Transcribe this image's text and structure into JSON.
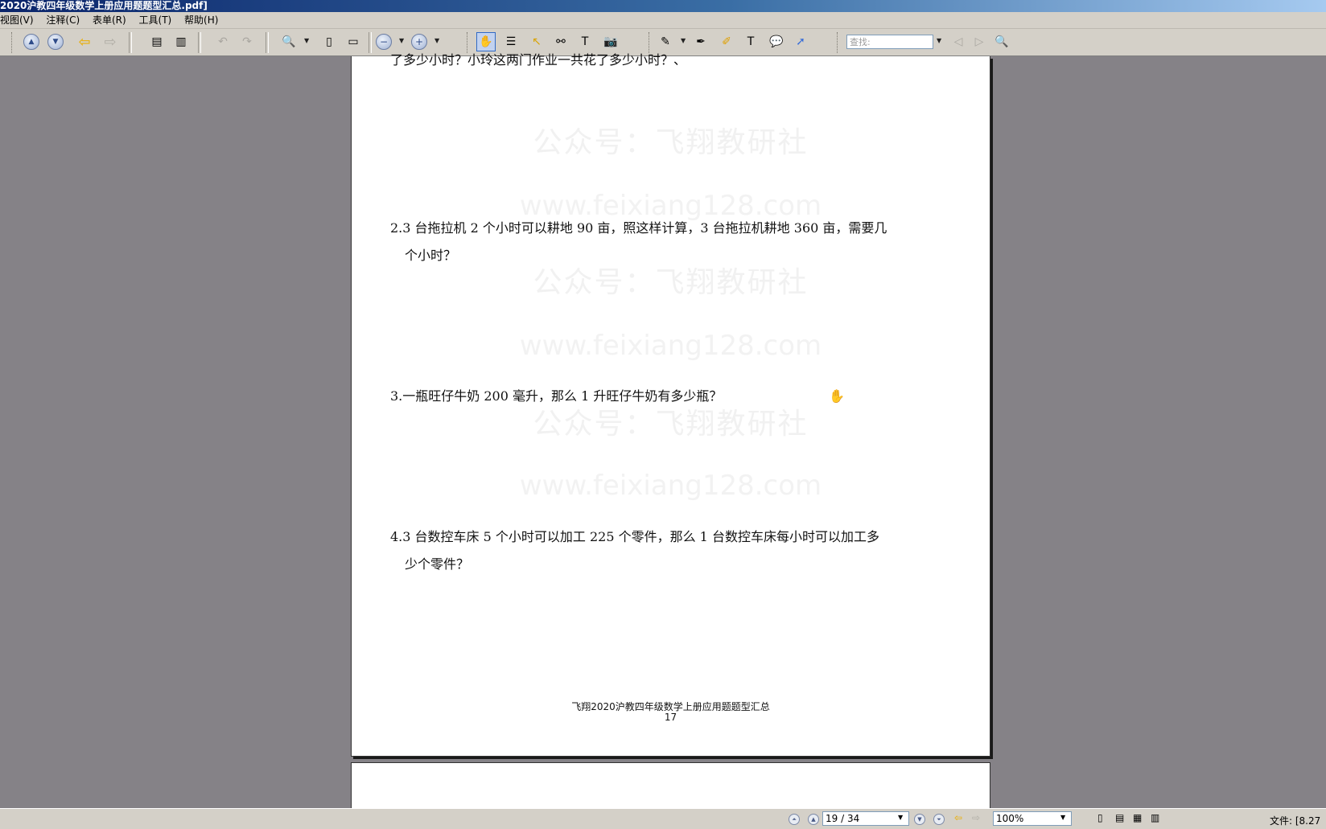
{
  "window": {
    "title": "2020沪教四年级数学上册应用题题型汇总.pdf]"
  },
  "menu": [
    "视图(V)",
    "注释(C)",
    "表单(R)",
    "工具(T)",
    "帮助(H)"
  ],
  "toolbar": {
    "search_placeholder": "查找:",
    "icons": [
      "prev-page-icon",
      "next-page-icon",
      "back-icon",
      "forward-icon",
      "extract-pages-icon",
      "insert-pages-icon",
      "undo-icon",
      "redo-icon",
      "zoom-in-tool-icon",
      "fit-page-icon",
      "fit-width-icon",
      "zoom-out-icon",
      "zoom-in-icon",
      "hand-tool-icon",
      "select-text-icon",
      "select-tool-icon",
      "find-icon",
      "typewriter-icon",
      "snapshot-icon",
      "edit-icon",
      "stamp-icon",
      "note-icon",
      "textbox-icon",
      "comment-icon",
      "arrow-icon",
      "search-prev-icon",
      "search-next-icon",
      "search-options-icon"
    ]
  },
  "document": {
    "partial_top_line": "了多少小时？小玲这两门作业一共花了多少小时？、",
    "watermark_cn": "公众号：飞翔教研社",
    "watermark_url": "www.feixiang128.com",
    "questions": [
      {
        "line1": "2.3 台拖拉机 2 个小时可以耕地 90 亩，照这样计算，3 台拖拉机耕地 360 亩，需要几",
        "line2": "个小时？"
      },
      {
        "line1": "3.一瓶旺仔牛奶 200 毫升，那么 1 升旺仔牛奶有多少瓶？",
        "line2": ""
      },
      {
        "line1": "4.3 台数控车床 5 个小时可以加工 225 个零件，那么 1 台数控车床每小时可以加工多",
        "line2": "少个零件？"
      }
    ],
    "footer_title": "飞翔2020沪教四年级数学上册应用题题型汇总",
    "footer_page": "17"
  },
  "status": {
    "page_indicator": "19 / 34",
    "zoom": "100%",
    "file_info": "文件: [8.27"
  }
}
